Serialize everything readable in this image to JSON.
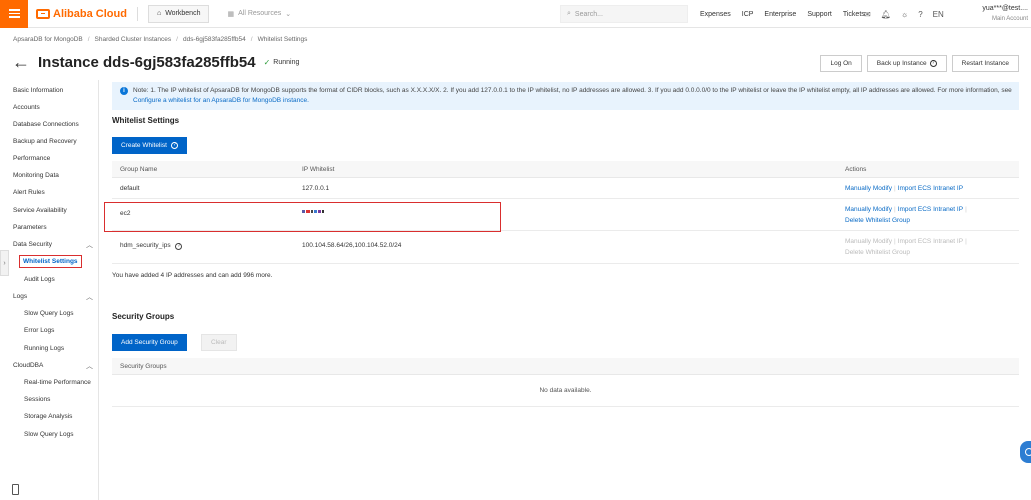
{
  "topbar": {
    "logo": "Alibaba Cloud",
    "workbench": "Workbench",
    "all_resources": "All Resources",
    "search_placeholder": "Search...",
    "links": [
      "Expenses",
      "ICP",
      "Enterprise",
      "Support",
      "Tickets"
    ],
    "lang": "EN",
    "account_user": "yua***@test....",
    "account_role": "Main Account"
  },
  "breadcrumb": [
    "ApsaraDB for MongoDB",
    "Sharded Cluster Instances",
    "dds-6gj583fa285ffb54",
    "Whitelist Settings"
  ],
  "header": {
    "title": "Instance dds-6gj583fa285ffb54",
    "status": "Running",
    "buttons": {
      "log_on": "Log On",
      "backup": "Back up Instance",
      "restart": "Restart Instance"
    }
  },
  "sidebar": {
    "items": [
      "Basic Information",
      "Accounts",
      "Database Connections",
      "Backup and Recovery",
      "Performance",
      "Monitoring Data",
      "Alert Rules",
      "Service Availability",
      "Parameters",
      "Data Security",
      "Whitelist Settings",
      "Audit Logs",
      "Logs",
      "Slow Query Logs",
      "Error Logs",
      "Running Logs",
      "CloudDBA",
      "Real-time Performance",
      "Sessions",
      "Storage Analysis",
      "Slow Query Logs"
    ]
  },
  "note": {
    "text": "Note: 1. The IP whitelist of ApsaraDB for MongoDB supports the format of CIDR blocks, such as X.X.X.X/X. 2. If you add 127.0.0.1 to the IP whitelist, no IP addresses are allowed. 3. If you add 0.0.0.0/0 to the IP whitelist or leave the IP whitelist empty, all IP addresses are allowed. For more information, see",
    "link": "Configure a whitelist for an ApsaraDB for MongoDB instance."
  },
  "whitelist": {
    "section_title": "Whitelist Settings",
    "create_button": "Create Whitelist",
    "columns": [
      "Group Name",
      "IP Whitelist",
      "Actions"
    ],
    "rows": [
      {
        "group": "default",
        "ips": "127.0.0.1",
        "actions": [
          "Manually Modify",
          "Import ECS Intranet IP"
        ]
      },
      {
        "group": "ec2",
        "ips": "",
        "actions": [
          "Manually Modify",
          "Import ECS Intranet IP",
          "Delete Whitelist Group"
        ]
      },
      {
        "group": "hdm_security_ips",
        "ips": "100.104.58.64/26,100.104.52.0/24",
        "actions": [
          "Manually Modify",
          "Import ECS Intranet IP",
          "Delete Whitelist Group"
        ]
      }
    ],
    "summary": "You have added 4 IP addresses and can add 996 more."
  },
  "security_groups": {
    "section_title": "Security Groups",
    "add_button": "Add Security Group",
    "clear_button": "Clear",
    "column": "Security Groups",
    "empty": "No data available."
  },
  "colors": {
    "brand": "#ff6a00",
    "primary": "#0064c8",
    "link": "#0a6bc6",
    "highlight": "#d92e2e"
  }
}
